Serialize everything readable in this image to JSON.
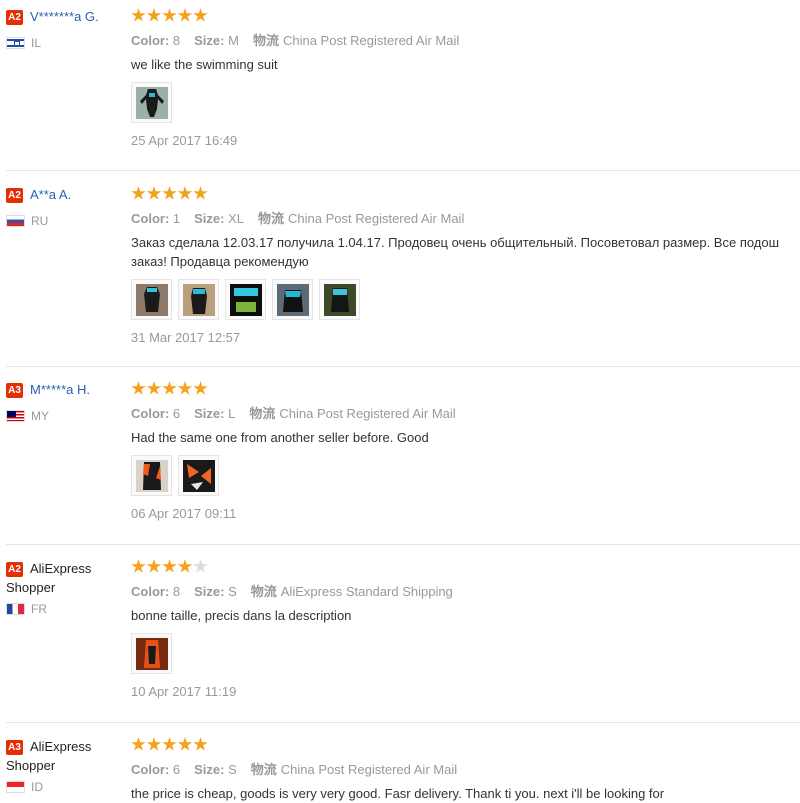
{
  "labels": {
    "color": "Color:",
    "size": "Size:",
    "shipping_prefix": "物流"
  },
  "reviews": [
    {
      "level": "A2",
      "name": "V*******a G.",
      "country": "IL",
      "stars": 5,
      "color": "8",
      "size": "M",
      "shipping": "China Post Registered Air Mail",
      "text": [
        "we like the swimming suit"
      ],
      "photos": [
        "photo-1"
      ],
      "date": "25 Apr 2017 16:49"
    },
    {
      "level": "A2",
      "name": "A**a A.",
      "country": "RU",
      "stars": 5,
      "color": "1",
      "size": "XL",
      "shipping": "China Post Registered Air Mail",
      "text": [
        "Заказ сделала 12.03.17 получила 1.04.17. Продовец очень общительный. Посоветовал размер. Все подош",
        "заказ! Продавца рекомендую"
      ],
      "photos": [
        "photo-1",
        "photo-2",
        "photo-3",
        "photo-4",
        "photo-5"
      ],
      "date": "31 Mar 2017 12:57"
    },
    {
      "level": "A3",
      "name": "M*****a H.",
      "country": "MY",
      "stars": 5,
      "color": "6",
      "size": "L",
      "shipping": "China Post Registered Air Mail",
      "text": [
        "Had the same one from another seller before. Good"
      ],
      "photos": [
        "photo-1",
        "photo-2"
      ],
      "date": "06 Apr 2017 09:11"
    },
    {
      "level": "A2",
      "name": "AliExpress Shopper",
      "country": "FR",
      "stars": 4,
      "color": "8",
      "size": "S",
      "shipping": "AliExpress Standard Shipping",
      "text": [
        "bonne taille, precis dans la description"
      ],
      "photos": [
        "photo-1"
      ],
      "date": "10 Apr 2017 11:19"
    },
    {
      "level": "A3",
      "name": "AliExpress Shopper",
      "country": "ID",
      "stars": 5,
      "color": "6",
      "size": "S",
      "shipping": "China Post Registered Air Mail",
      "text": [
        "the price is cheap, goods is very very good. Fasr delivery. Thank ti you. next i'll be looking for"
      ],
      "photos": [],
      "date": ""
    }
  ],
  "colors": {
    "accent_star": "#f7a01b",
    "username_blue": "#2a5eb5",
    "level_badge": "#e62e04"
  }
}
